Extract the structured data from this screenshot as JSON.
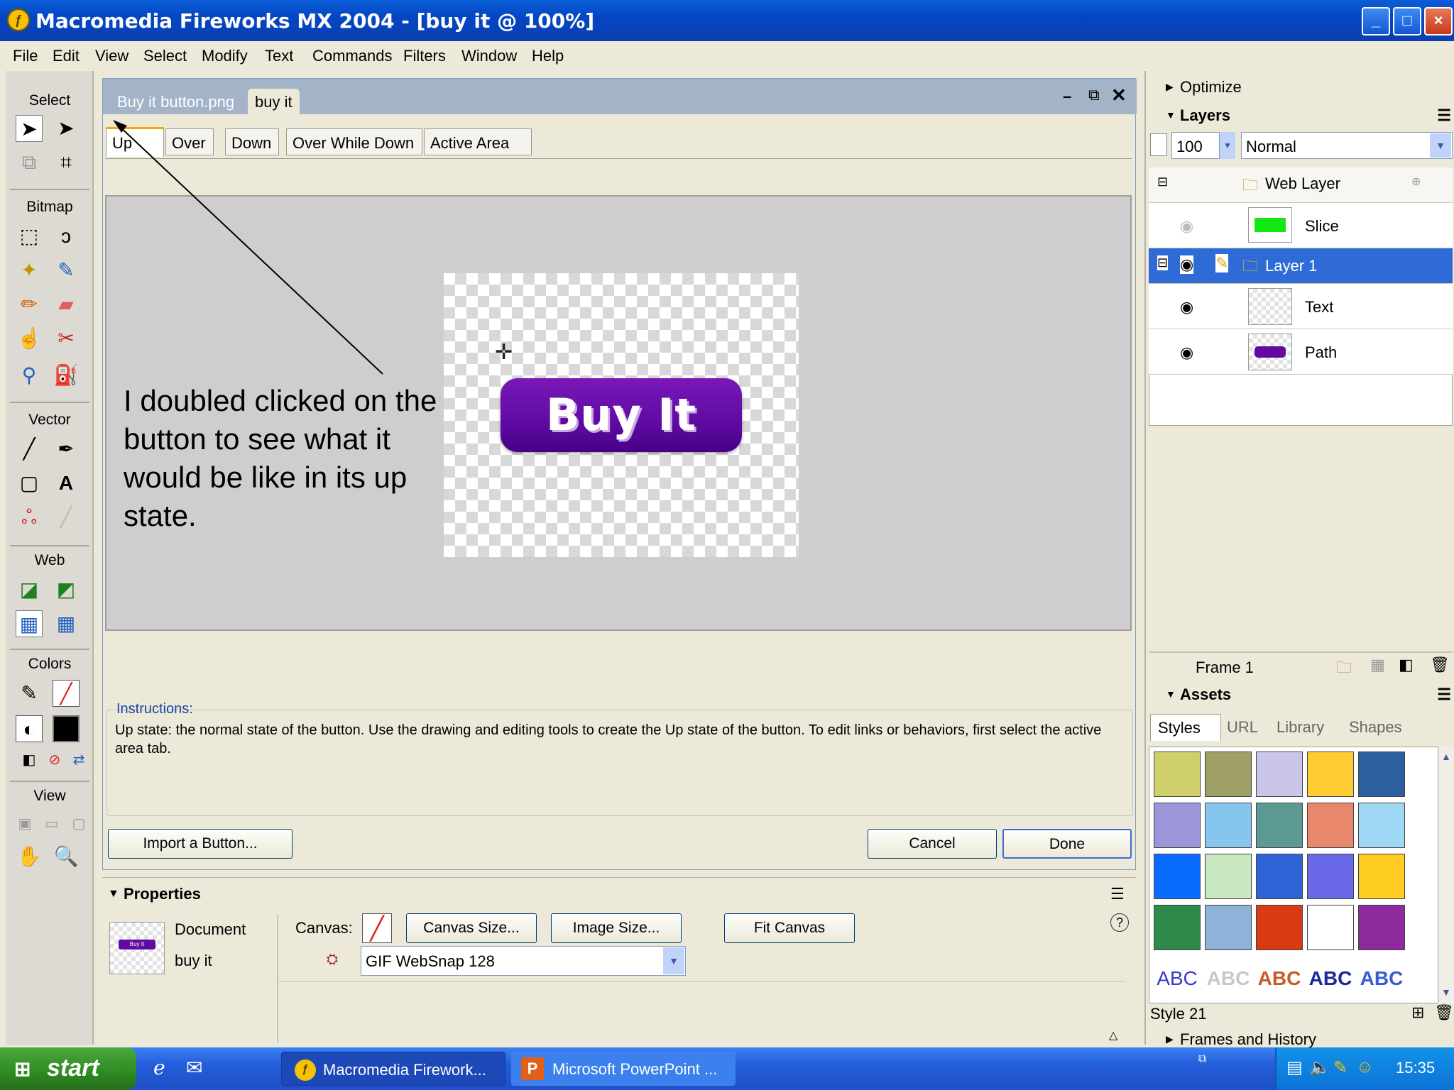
{
  "window": {
    "title": "Macromedia Fireworks MX 2004 - [buy it @ 100%]",
    "buttons": {
      "minimize": "_",
      "maximize": "□",
      "close": "×"
    }
  },
  "menu": [
    "File",
    "Edit",
    "View",
    "Select",
    "Modify",
    "Text",
    "Commands",
    "Filters",
    "Window",
    "Help"
  ],
  "tools": {
    "sections": [
      "Select",
      "Bitmap",
      "Vector",
      "Web",
      "Colors",
      "View"
    ]
  },
  "document": {
    "tabs": [
      "Buy it button.png",
      "buy it"
    ],
    "state_tabs": [
      "Up",
      "Over",
      "Down",
      "Over While Down",
      "Active Area"
    ],
    "button_text": "Buy It",
    "annotation": "I doubled clicked on the button to see what it would be like in its up state.",
    "instructions_label": "Instructions:",
    "instructions_text": "Up state: the normal state of the button. Use the drawing and editing tools to create the Up state of the button. To edit links or behaviors, first select the active area tab.",
    "import_button": "Import a Button...",
    "cancel_button": "Cancel",
    "done_button": "Done"
  },
  "properties": {
    "title": "Properties",
    "doc_label": "Document",
    "doc_name": "buy it",
    "canvas_label": "Canvas:",
    "canvas_size_button": "Canvas Size...",
    "image_size_button": "Image Size...",
    "fit_canvas_button": "Fit Canvas",
    "export_setting": "GIF WebSnap 128",
    "thumb_text": "Buy It"
  },
  "panels": {
    "optimize": "Optimize",
    "layers": {
      "title": "Layers",
      "opacity": "100",
      "blend": "Normal",
      "web_layer": "Web Layer",
      "slice": "Slice",
      "layer1": "Layer 1",
      "text": "Text",
      "path": "Path",
      "frame": "Frame 1"
    },
    "assets": {
      "title": "Assets",
      "tabs": [
        "Styles",
        "URL",
        "Library",
        "Shapes"
      ],
      "style_name": "Style 21",
      "style_sample": "ABC"
    },
    "frames": "Frames and History",
    "swatch_colors": [
      "#cfcf6b",
      "#9ea066",
      "#c9c6ea",
      "#ffcc33",
      "#2d5f9e",
      "#9a96d8",
      "#86c6ee",
      "#5a9a92",
      "#e8876a",
      "#9fd8f4",
      "#0a6cff",
      "#c8e8c0",
      "#2f63d6",
      "#6a6ae8",
      "#ffcc22",
      "#2e8a4a",
      "#8fb2d8",
      "#d83a12",
      "#ffffff",
      "#8e2a9e"
    ]
  },
  "taskbar": {
    "start": "start",
    "tasks": [
      "Macromedia Firework...",
      "Microsoft PowerPoint ..."
    ],
    "clock": "15:35"
  }
}
